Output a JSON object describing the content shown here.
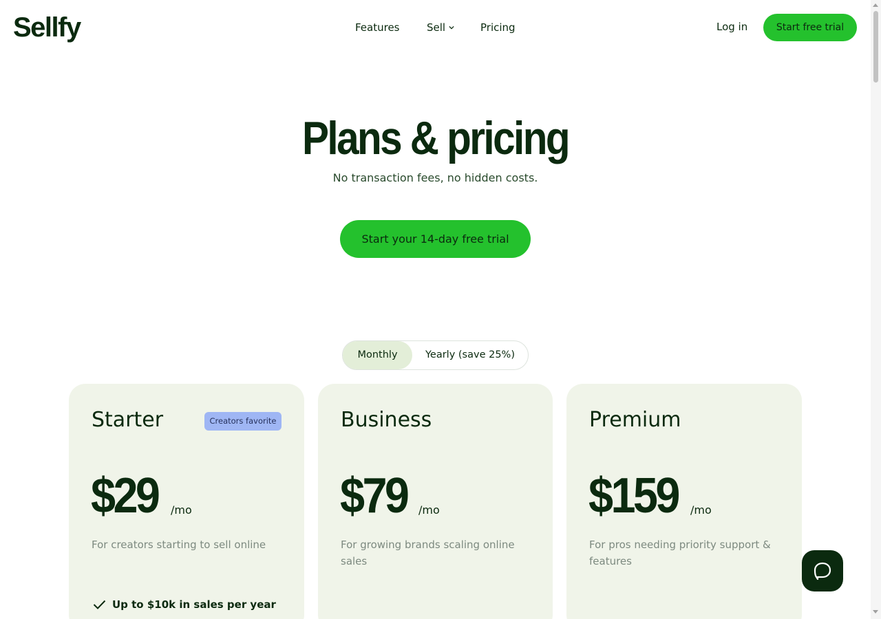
{
  "header": {
    "logo": "Sellfy",
    "nav": {
      "features": "Features",
      "sell": "Sell",
      "pricing": "Pricing"
    },
    "login": "Log in",
    "cta": "Start free trial"
  },
  "hero": {
    "title": "Plans & pricing",
    "subtitle": "No transaction fees, no hidden costs.",
    "cta": "Start your 14-day free trial"
  },
  "billing_toggle": {
    "monthly": "Monthly",
    "yearly": "Yearly (save 25%)",
    "selected": "Monthly"
  },
  "plans": [
    {
      "name": "Starter",
      "badge": "Creators favorite",
      "price": "$29",
      "unit": "/mo",
      "description": "For creators starting to sell online",
      "feature": "Up to $10k in sales per year"
    },
    {
      "name": "Business",
      "price": "$79",
      "unit": "/mo",
      "description": "For growing brands scaling online sales"
    },
    {
      "name": "Premium",
      "price": "$159",
      "unit": "/mo",
      "description": "For pros needing priority support & features"
    }
  ],
  "colors": {
    "brand_green": "#24c12d",
    "dark_text": "#0b2a0f",
    "card_bg": "#f0f4e9",
    "badge_bg": "#9fb6f4",
    "toggle_active_bg": "#e3eed8"
  }
}
